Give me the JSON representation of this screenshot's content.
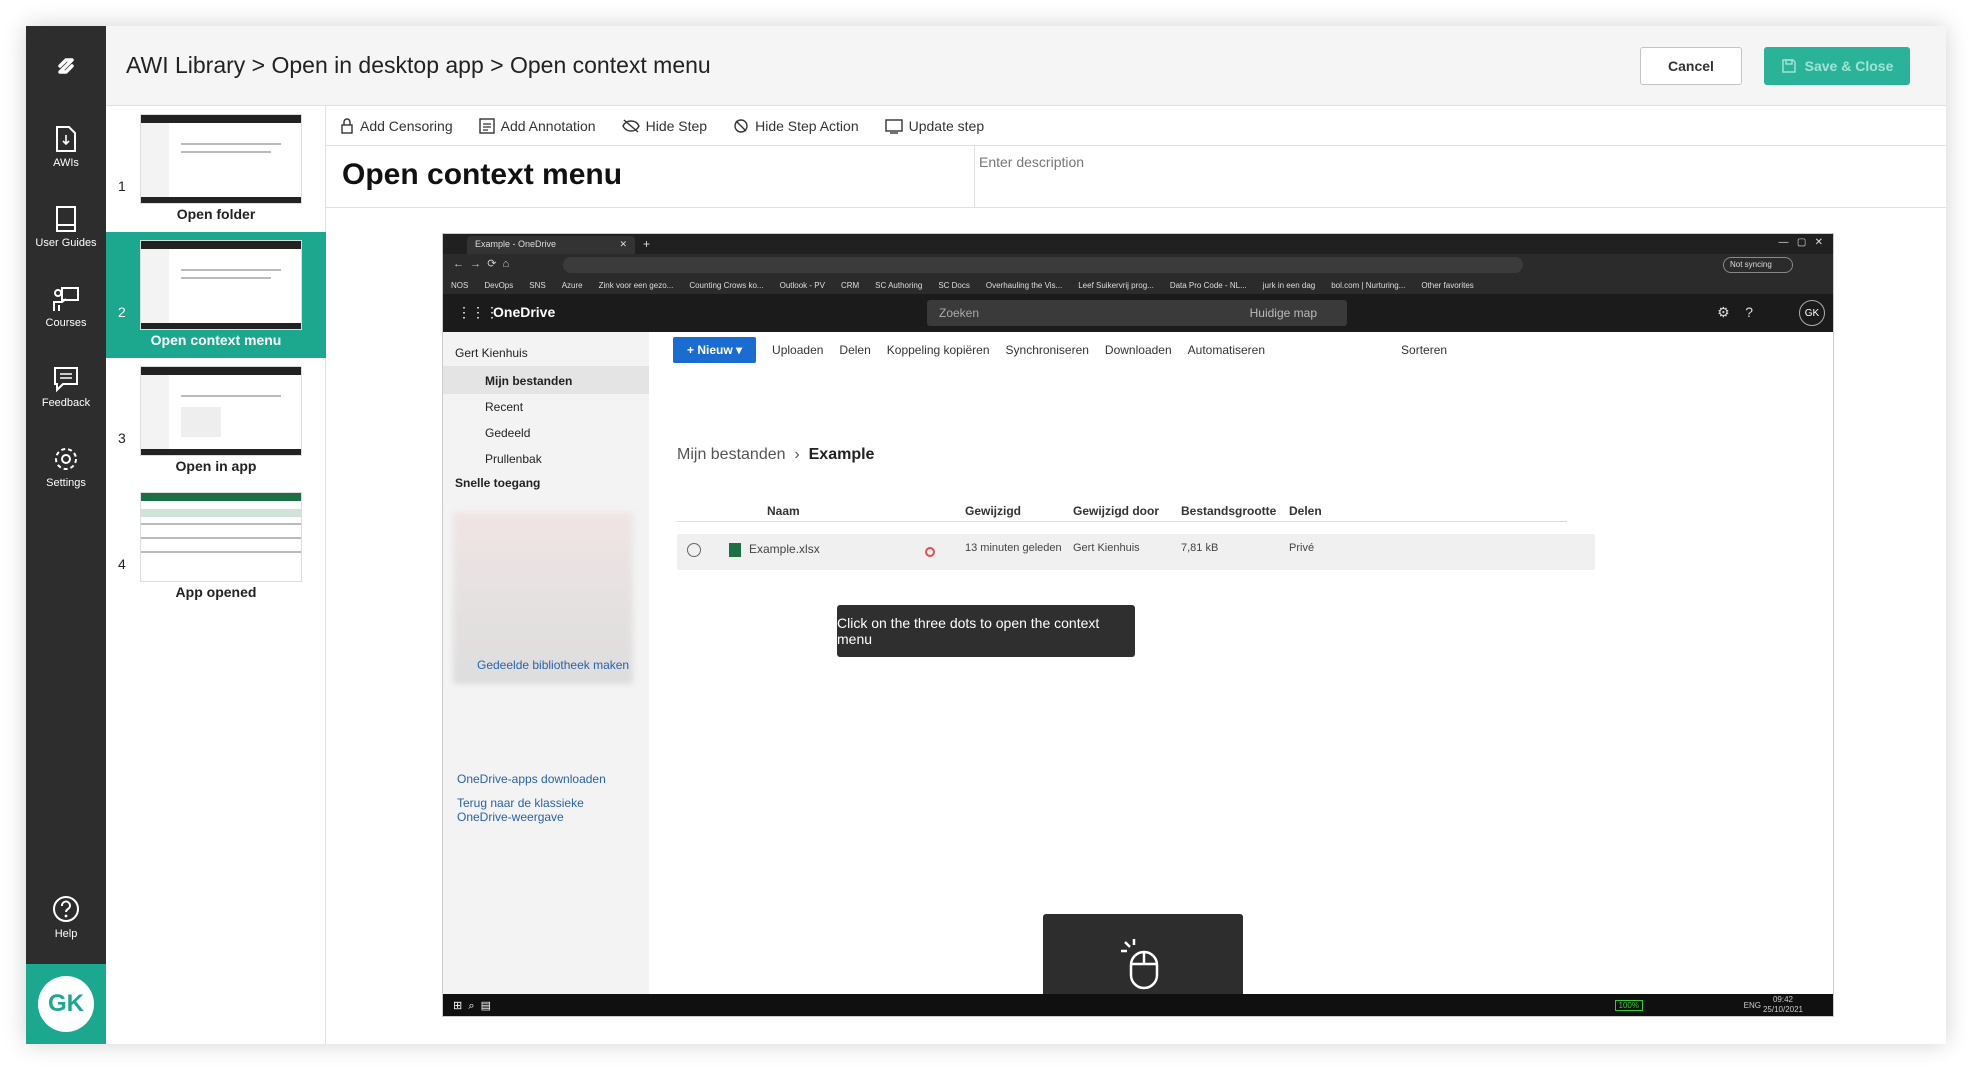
{
  "app": {
    "breadcrumb": "AWI Library > Open in desktop app > Open context menu",
    "cancel_label": "Cancel",
    "save_label": "Save & Close",
    "avatar_initials": "GK",
    "accent_color": "#1ba88f"
  },
  "rail": {
    "items": [
      {
        "label": "AWIs",
        "icon": "document-icon"
      },
      {
        "label": "User Guides",
        "icon": "book-icon"
      },
      {
        "label": "Courses",
        "icon": "teacher-icon"
      },
      {
        "label": "Feedback",
        "icon": "feedback-icon"
      },
      {
        "label": "Settings",
        "icon": "gear-icon"
      }
    ],
    "help_label": "Help"
  },
  "steps": [
    {
      "num": "1",
      "label": "Open folder"
    },
    {
      "num": "2",
      "label": "Open context menu"
    },
    {
      "num": "3",
      "label": "Open in app"
    },
    {
      "num": "4",
      "label": "App opened"
    }
  ],
  "toolbar": {
    "add_censoring": "Add Censoring",
    "add_annotation": "Add Annotation",
    "hide_step": "Hide Step",
    "hide_step_action": "Hide Step Action",
    "update_step": "Update step"
  },
  "step_title": "Open context menu",
  "description_placeholder": "Enter description",
  "screenshot": {
    "tab_title": "Example - OneDrive",
    "not_syncing": "Not syncing",
    "favorites": [
      "NOS",
      "DevOps",
      "SNS",
      "Azure",
      "Zink voor een gezo...",
      "Counting Crows ko...",
      "Outlook - PV",
      "CRM",
      "SC Authoring",
      "SC Docs",
      "Overhauling the Vis...",
      "Leef Suikervrij prog...",
      "Data Pro Code - NL...",
      "jurk in een dag",
      "bol.com | Nurturing...",
      "Other favorites"
    ],
    "app_name": "OneDrive",
    "search_placeholder": "Zoeken",
    "search_scope": "Huidige map",
    "user_initials": "GK",
    "owner": "Gert Kienhuis",
    "nav": [
      "Mijn bestanden",
      "Recent",
      "Gedeeld",
      "Prullenbak"
    ],
    "quick_access": "Snelle toegang",
    "shared_library": "Gedeelde bibliotheek maken",
    "apps_download": "OneDrive-apps downloaden",
    "classic_line1": "Terug naar de klassieke",
    "classic_line2": "OneDrive-weergave",
    "commands": [
      "Nieuw",
      "Uploaden",
      "Delen",
      "Koppeling kopiëren",
      "Synchroniseren",
      "Downloaden",
      "Automatiseren"
    ],
    "sort_label": "Sorteren",
    "crumb_root": "Mijn bestanden",
    "crumb_current": "Example",
    "columns": [
      "Naam",
      "Gewijzigd",
      "Gewijzigd door",
      "Bestandsgrootte",
      "Delen"
    ],
    "file": {
      "name": "Example.xlsx",
      "modified": "13 minuten geleden",
      "modified_by": "Gert Kienhuis",
      "size": "7,81 kB",
      "sharing": "Privé"
    },
    "tooltip": "Click on the three dots to open the context menu",
    "battery": "100%",
    "lang": "ENG",
    "time": "09:42",
    "date": "25/10/2021"
  }
}
